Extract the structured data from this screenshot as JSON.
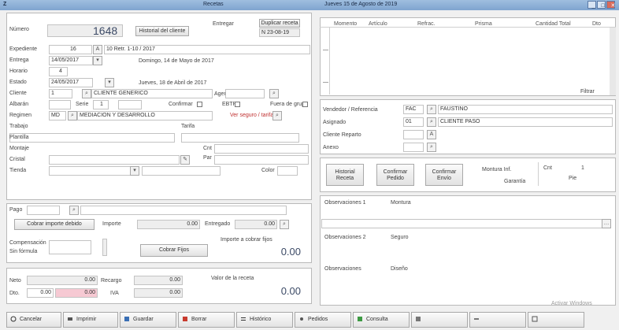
{
  "window": {
    "title_left": "Z",
    "title_center": "Recetas",
    "title_right": "Jueves 15 de Agosto de 2019",
    "controls": [
      "_",
      "□",
      "✕"
    ]
  },
  "form": {
    "numero_label": "Número",
    "numero_value": "1648",
    "historial_btn": "Historial del cliente",
    "entregar_label": "Entregar",
    "duplicar_btn": "Duplicar receta",
    "entregar_value": "N 23-08-19",
    "expediente_label": "Expediente",
    "expediente_code": "16",
    "expediente_text": "10 Retr. 1-10 / 2017",
    "entrega_label": "Entrega",
    "entrega_date": "14/05/2017",
    "entrega_text": "Domingo, 14 de Mayo de 2017",
    "horario_label": "Horario",
    "horario_value": "4",
    "estado_label": "Estado",
    "estado_date": "24/05/2017",
    "estado_text": "Jueves, 18 de Abril de 2017",
    "cliente_label": "Cliente",
    "cliente_code": "1",
    "cliente_name": "CLIENTE GENERICO",
    "agente_label": "Agente",
    "albaran_label": "Albarán",
    "serie_label": "Serie",
    "serie_value": "1",
    "confirmar_label": "Confirmar",
    "ebtp_label": "EBTP",
    "fuera_label": "Fuera de grupo",
    "regimen_label": "Regimen",
    "regimen_code": "MD",
    "regimen_name": "MEDIACION Y DESARROLLO",
    "regimen_red": "Ver seguro / tarifa",
    "trabajo_label": "Trabajo",
    "tarifa_label": "Tarifa",
    "plantilla_label": "Plantilla",
    "montaje_label": "Montaje",
    "cnt_label": "Cnt",
    "cristal_label": "Cristal",
    "par_label": "Par",
    "tienda_label": "Tienda",
    "color_label": "Color"
  },
  "pago": {
    "pago_label": "Pago",
    "cobrar_btn": "Cobrar importe debido",
    "importe_label": "Importe",
    "importe_value": "0.00",
    "entregado_label": "Entregado",
    "entregado_value": "0.00",
    "compensacion_label": "Compensación",
    "sin_formula_label": "Sin fórmula",
    "cobrar_fijos_btn": "Cobrar Fijos",
    "importe_cobrar_label": "Importe a cobrar fijos",
    "importe_cobrar_value": "0.00"
  },
  "totales": {
    "neto_label": "Neto",
    "neto_value": "0.00",
    "descuento_label": "Dto.",
    "descuento_pct": "0.00",
    "descuento_value": "0.00",
    "iva_label": "IVA",
    "iva_value": "0.00",
    "recargo_label": "Recargo",
    "recargo_value": "0.00",
    "total_label": "Valor de la receta",
    "total_value": "0.00"
  },
  "grid": {
    "columns": [
      "Momento",
      "Artículo",
      "Refrac.",
      "Prisma",
      "Cantidad Total",
      "Dto"
    ],
    "filter_label": "Filtrar"
  },
  "right_form": {
    "vendedor_label": "Vendedor / Referencia",
    "vendedor_code": "FAC",
    "vendedor_name": "FAUSTINO",
    "asignado_label": "Asignado",
    "asignado_code": "01",
    "asignado_name": "CLIENTE PASO",
    "cliente_reparto_label": "Cliente Reparto",
    "anexo_label": "Anexo",
    "btn_historial": "Historial Receta",
    "btn_confirmar": "Confirmar Pedido",
    "btn_confirmar_envio": "Confirmar Envío",
    "montura_label": "Montura Inf.",
    "garantia_label": "Garantía",
    "cnt_label": "Cnt",
    "cnt_value": "1",
    "pie_label": "Pie",
    "observ1_label": "Observaciones 1",
    "observ1_value": "Montura",
    "observ2_label": "Observaciones 2",
    "observ2_value": "Seguro",
    "observaciones_label": "Observaciones",
    "observaciones_value": "Diseño"
  },
  "footer": {
    "buttons": [
      "Cancelar",
      "Imprimir",
      "Guardar",
      "Borrar",
      "Histórico",
      "Pedidos",
      "Consulta",
      "",
      "",
      ""
    ],
    "watermark": "Activar Windows"
  },
  "colors": {
    "titlebar": "#8fb0d8",
    "pink_field": "#f6c9d3",
    "red_text": "#c03030",
    "accent": "#3c4a66"
  }
}
